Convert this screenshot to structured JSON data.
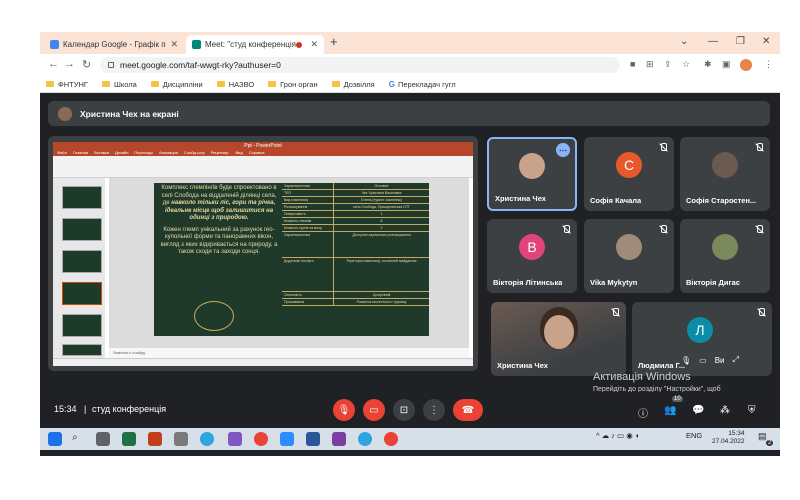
{
  "browser": {
    "tabs": [
      {
        "title": "Календар Google - Графік поче",
        "favicon_color": "#4285f4"
      },
      {
        "title": "Meet: \"студ конференція\"",
        "favicon_color": "#00897b",
        "recording": true
      }
    ],
    "new_tab": "+",
    "window_controls": [
      "⌄",
      "—",
      "❐",
      "✕"
    ],
    "url": "meet.google.com/taf-wwgt-rky?authuser=0",
    "bookmarks": [
      {
        "label": "ФНТУНГ",
        "type": "folder"
      },
      {
        "label": "Школа",
        "type": "folder"
      },
      {
        "label": "Дисципліни",
        "type": "folder"
      },
      {
        "label": "НАЗВО",
        "type": "folder"
      },
      {
        "label": "Грон орган",
        "type": "folder"
      },
      {
        "label": "Дозвілля",
        "type": "folder"
      },
      {
        "label": "Перекладач гугл",
        "type": "google"
      }
    ]
  },
  "meet": {
    "presenting_banner": "Христина Чех на екрані",
    "slide": {
      "window_title": "Ppt - PowerPoint",
      "menu": [
        "Файл",
        "Главная",
        "Вставка",
        "Дизайн",
        "Переходы",
        "Анимация",
        "Слайд-шоу",
        "Рецензир.",
        "Вид",
        "Справка"
      ],
      "text_p1_a": "Комплекс глемпінгів буде спроектовано в селі Слобода на віддаленій ділянці села, де ",
      "text_p1_b": "навколо тільки ліс, гори та річка, ідеальне місце щоб залишитися на одинці з природою.",
      "text_p2": "Кожен глемп унікальний за рахунок гео-купольної форми та панорамних вікон, вигляд з яких відкривається на природу, а також сходи та заходи сонця.",
      "table": [
        [
          "Характеристики",
          "Основне"
        ],
        [
          "ТЕП",
          "Чех Христина Василівна"
        ],
        [
          "Вид комплексу",
          "Готель (турист. комплекс)"
        ],
        [
          "Розташування",
          "село Слобода, Прикарпатська ОТГ"
        ],
        [
          "Поверховість",
          "1"
        ],
        [
          "Кількість глемпів",
          "8"
        ],
        [
          "Кількість гуртів на місці",
          "2"
        ],
        [
          "Характеристика",
          "Доступне карпатське розташування"
        ],
        [
          "Додаткові послуги",
          "Територія комплексу, гостинний майданчик"
        ],
        [
          "Сезонність",
          "Цілорічний"
        ],
        [
          "Проживання",
          "Розвиток екологічного туризму"
        ]
      ],
      "notes_placeholder": "Заметки к слайду"
    },
    "participants": [
      {
        "name": "Христина Чех",
        "type": "photo",
        "active": true,
        "more": true,
        "muted": false
      },
      {
        "name": "Софія Качала",
        "type": "initial",
        "initial": "С",
        "color": "#e8582a",
        "muted": true
      },
      {
        "name": "Софія Старостен...",
        "type": "photo",
        "muted": true
      },
      {
        "name": "Вікторія Літинська",
        "type": "initial",
        "initial": "В",
        "color": "#e2447a",
        "muted": true
      },
      {
        "name": "Vika Mykytyn",
        "type": "photo",
        "muted": true
      },
      {
        "name": "Вікторія Дигас",
        "type": "photo",
        "muted": true
      },
      {
        "name": "Христина Чех",
        "type": "video",
        "muted": true
      },
      {
        "name": "Людмила Г...",
        "type": "initial",
        "initial": "Л",
        "color": "#0b8da8",
        "muted": true
      }
    ],
    "self_view_label": "Ви",
    "watermark_title": "Активація Windows",
    "watermark_sub": "Перейдіть до розділу \"Настройки\", щоб активувати Windows.",
    "bottom": {
      "time": "15:34",
      "separator": "|",
      "meeting_name": "студ конференція",
      "participant_badge": "10"
    }
  },
  "taskbar": {
    "lang": "ENG",
    "clock_time": "15:34",
    "clock_date": "27.04.2022",
    "notification_badge": "2"
  }
}
